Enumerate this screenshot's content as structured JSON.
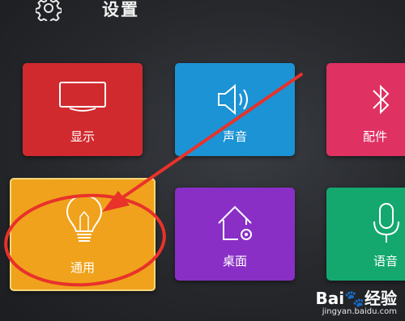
{
  "header": {
    "title": "设置",
    "icon": "gear-icon"
  },
  "tiles": [
    {
      "id": "display",
      "label": "显示",
      "icon": "tv-icon",
      "color": "#d12a2e"
    },
    {
      "id": "sound",
      "label": "声音",
      "icon": "speaker-icon",
      "color": "#1c93d4"
    },
    {
      "id": "accessory",
      "label": "配件",
      "icon": "bluetooth-icon",
      "color": "#e03163"
    },
    {
      "id": "general",
      "label": "通用",
      "icon": "lightbulb-icon",
      "color": "#f0a21c",
      "selected": true
    },
    {
      "id": "desktop",
      "label": "桌面",
      "icon": "home-settings-icon",
      "color": "#8a2fc6"
    },
    {
      "id": "voice",
      "label": "语音",
      "icon": "microphone-icon",
      "color": "#14a86f"
    }
  ],
  "annotation": {
    "color": "#e8322a"
  },
  "watermark": {
    "logo": "Bai",
    "logo_suffix": "经验",
    "site": "jingyan.baidu.com"
  }
}
